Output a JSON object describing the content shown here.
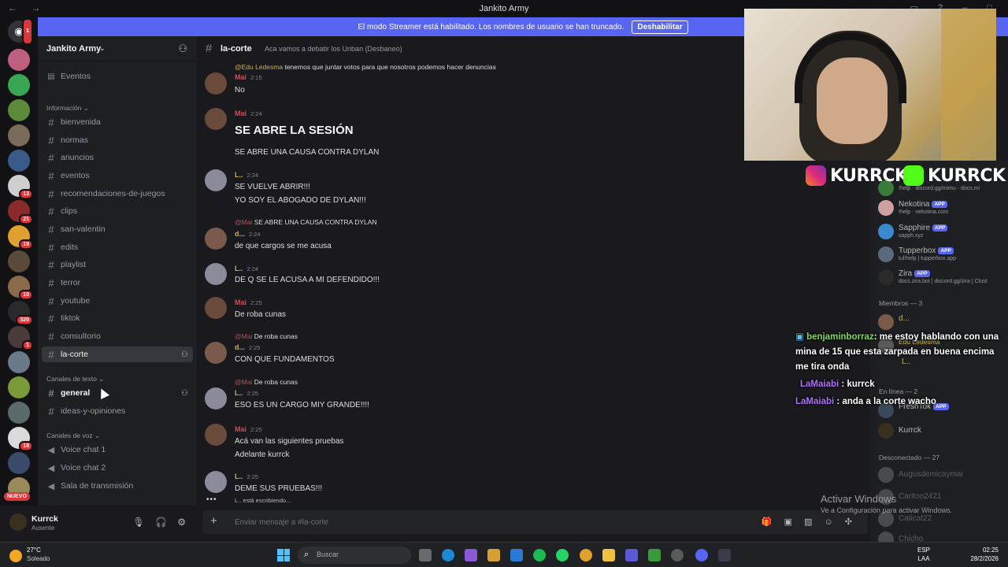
{
  "window": {
    "title": "Jankito Army",
    "back_icon": "arrow-left-icon",
    "forward_icon": "arrow-right-icon"
  },
  "banner": {
    "text": "El modo Streamer está habilitado. Los nombres de usuario se han truncado.",
    "button": "Deshabilitar"
  },
  "servers": {
    "badges": [
      "1",
      "13",
      "21",
      "19",
      "10",
      "320",
      "1",
      "18"
    ],
    "new_label": "NUEVO"
  },
  "guild": {
    "name": "Jankito Army"
  },
  "sidebar": {
    "events": "Eventos",
    "cat_info": "Información",
    "info_channels": [
      "bienvenida",
      "normas",
      "anuncios",
      "eventos",
      "recomendaciones-de-juegos",
      "clips",
      "san-valentin",
      "edits",
      "playlist",
      "terror",
      "youtube",
      "tiktok",
      "consultorio",
      "la-corte"
    ],
    "cat_text": "Canales de texto",
    "text_channels": [
      "general",
      "ideas-y-opiniones"
    ],
    "cat_voice": "Canales de voz",
    "voice_channels": [
      "Voice chat 1",
      "Voice chat 2",
      "Sala de transmisión"
    ]
  },
  "user": {
    "name": "Kurrck",
    "status": "Ausente"
  },
  "channel": {
    "name": "la-corte",
    "topic": "Aca vamos a debatir los Unban (Desbaneo)"
  },
  "messages": [
    {
      "reply_name": "@Edu Ledesma",
      "reply_text": "tenemos que juntar votos para que nosotros podemos hacer denuncias",
      "author": "Mai",
      "time": "2:15",
      "text": "No"
    },
    {
      "author": "Mai",
      "time": "2:24",
      "text": "SE ABRE LA SESIÓN",
      "text2": "SE ABRE UNA CAUSA CONTRA DYLAN"
    },
    {
      "author": "L..",
      "time": "2:24",
      "text": "SE VUELVE ABRIR!!!",
      "text2": "YO SOY EL ABOGADO DE DYLAN!!!"
    },
    {
      "reply_name": "@Mai",
      "reply_text": "SE ABRE UNA CAUSA CONTRA DYLAN",
      "author": "d...",
      "time": "2:24",
      "text": "de que cargos se me acusa"
    },
    {
      "author": "L..",
      "time": "2:24",
      "text": "DE Q SE LE ACUSA A MI DEFENDIDO!!!"
    },
    {
      "author": "Mai",
      "time": "2:25",
      "text": "De roba cunas"
    },
    {
      "reply_name": "@Mai",
      "reply_text": "De roba cunas",
      "author": "d...",
      "time": "2:25",
      "text": "CON QUE FUNDAMENTOS"
    },
    {
      "reply_name": "@Mai",
      "reply_text": "De roba cunas",
      "author": "L..",
      "time": "2:25",
      "text": "ESO ES UN CARGO MIY GRANDE!!!!"
    },
    {
      "author": "Mai",
      "time": "2:25",
      "text": "Acá van las siguientes pruebas",
      "text2": "Adelante kurrck"
    },
    {
      "author": "L..",
      "time": "2:25",
      "text": "DEME SUS PRUEBAS!!!"
    }
  ],
  "typing": "L.. está escribiendo...",
  "composer": {
    "placeholder": "Enviar mensaje a #la-corte"
  },
  "members": {
    "bots": [
      {
        "name": "Nekotina",
        "status": "!help · nekotina.com"
      },
      {
        "name": "Sapphire",
        "status": "sapph.xyz"
      },
      {
        "name": "Tupperbox",
        "status": "tul!help | tupperbox.app"
      },
      {
        "name": "Zira",
        "status": "docs.zira.bot | discord.gg/zira | Clust"
      }
    ],
    "top_status": "!help · discord.gg/mimu · docs.mi",
    "app_label": "APP",
    "members_header": "Miembros — 3",
    "members_list": [
      "d...",
      "Edu Ledesma",
      "L.."
    ],
    "online_header": "En línea — 2",
    "online_list": [
      "FreshTok",
      "Kurrck"
    ],
    "offline_header": "Desconectado — 27",
    "offline_list": [
      "Augusdemicaymai",
      "Caritoo2421",
      "Caticat22",
      "Chicho"
    ]
  },
  "stream": {
    "brand_ig": "KURRCK",
    "brand_kick": "KURRCK",
    "chat": [
      {
        "name": "benjaminborraz",
        "text": ": me estoy hablando con una mina de 15 que esta zarpada en buena encima me tira onda"
      },
      {
        "name": "LaMaiabi",
        "text": ": kurrck"
      },
      {
        "name": "LaMaiabi",
        "text": ": anda a la corte wacho"
      }
    ]
  },
  "activate": {
    "title": "Activar Windows",
    "sub": "Ve a Configuración para activar Windows."
  },
  "taskbar": {
    "temp": "27°C",
    "weather": "Soleado",
    "search": "Buscar",
    "lang": "ESP",
    "lang2": "LAA",
    "time": "02:25",
    "date": "28/2/2026"
  }
}
